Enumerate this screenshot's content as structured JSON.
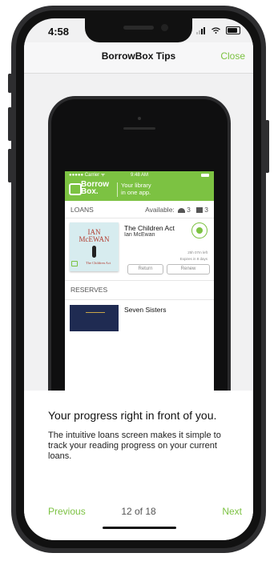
{
  "status_bar": {
    "time": "4:58"
  },
  "nav": {
    "title": "BorrowBox Tips",
    "close_label": "Close"
  },
  "demo": {
    "status": {
      "carrier": "●●●●● Carrier ᯤ",
      "time": "9:48 AM"
    },
    "header": {
      "logo_line1": "Borrow",
      "logo_line2": "Box.",
      "tagline_line1": "Your library",
      "tagline_line2": "in one app."
    },
    "loans": {
      "label": "LOANS",
      "available_label": "Available:",
      "audio_count": "3",
      "ebook_count": "3"
    },
    "loan_item": {
      "cover_author_line1": "IAN",
      "cover_author_line2": "McEWAN",
      "cover_title": "The Children Act",
      "title": "The Children Act",
      "author": "Ian McEwan",
      "time_left": "25h 07m left",
      "expires": "Expires in 8 days",
      "return_label": "Return",
      "renew_label": "Renew"
    },
    "reserves": {
      "label": "RESERVES"
    },
    "reserve_item": {
      "title": "Seven Sisters"
    }
  },
  "content": {
    "headline": "Your progress right in front of you.",
    "description": "The intuitive loans screen makes it simple to track your reading progress on your current loans."
  },
  "footer": {
    "previous_label": "Previous",
    "pager": "12 of 18",
    "next_label": "Next"
  },
  "colors": {
    "accent": "#7cc242",
    "phone_frame": "#2e2e30"
  }
}
